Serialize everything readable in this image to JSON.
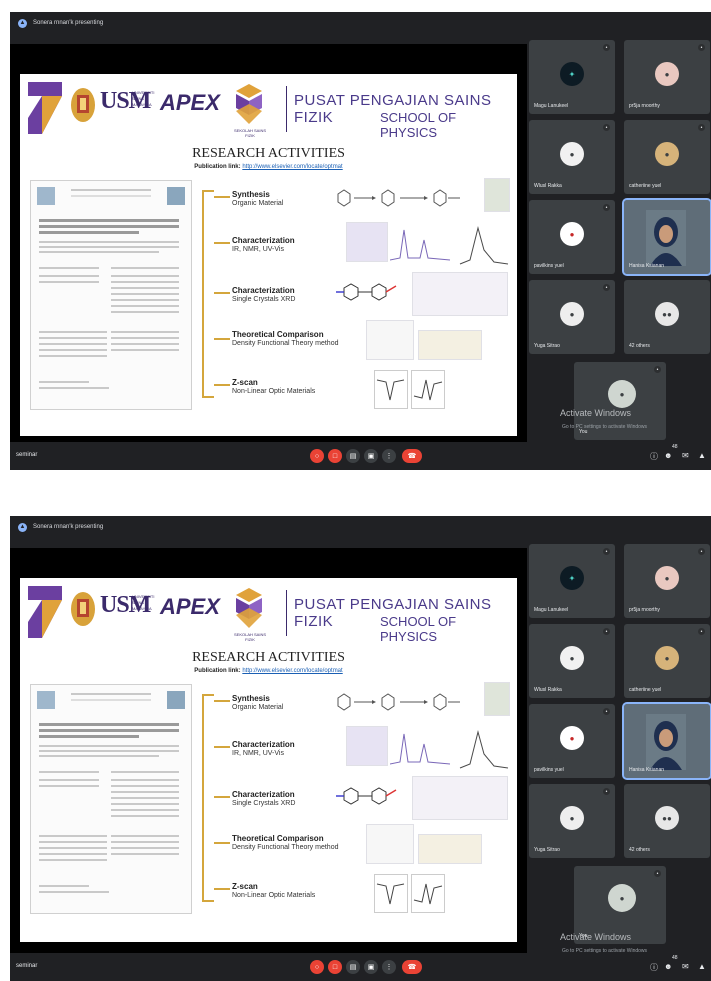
{
  "screens": [
    {
      "topbar": {
        "recording_icon": "present-icon",
        "recording_text": "Sonera rnnan'k presenting"
      },
      "slide": {
        "school_malay": "PUSAT PENGAJIAN SAINS FIZIK",
        "school_english": "SCHOOL OF PHYSICS",
        "usm_text": "USM",
        "usm_subtitle": "UNIVERSITI SAINS MALAYSIA",
        "apex_text": "APEX",
        "cube_label": "SEKOLAH SAINS FIZIK",
        "title": "RESEARCH ACTIVITIES",
        "publication_label": "Publication link:",
        "publication_url": "http://www.elsevier.com/locate/optmat",
        "activities": [
          {
            "heading": "Synthesis",
            "detail": "Organic Material"
          },
          {
            "heading": "Characterization",
            "detail": "IR, NMR, UV-Vis"
          },
          {
            "heading": "Characterization",
            "detail": "Single Crystals XRD"
          },
          {
            "heading": "Theoretical Comparison",
            "detail": "Density Functional Theory method"
          },
          {
            "heading": "Z-scan",
            "detail": "Non-Linear Optic Materials"
          }
        ]
      },
      "participants": [
        {
          "name": "Magu Lanukeel",
          "avatar": "abstract-avatar"
        },
        {
          "name": "pr5ja rnoorthy",
          "avatar": "portrait-avatar"
        },
        {
          "name": "Wlusl Rakka",
          "avatar": "portrait-avatar"
        },
        {
          "name": "catheriine yuel",
          "avatar": "portrait-avatar"
        },
        {
          "name": "pavilkins yuel",
          "avatar": "cartoon-avatar"
        },
        {
          "name": "Hanisa Ksianan",
          "avatar": "presenter-video"
        },
        {
          "name": "Yuga Sitrao",
          "avatar": "portrait-avatar"
        },
        {
          "name": "42 others",
          "avatar": "group-avatar"
        },
        {
          "name": "You",
          "avatar": "self-avatar"
        }
      ],
      "watermark": {
        "title": "Activate Windows",
        "subtitle": "Go to PC settings to activate Windows"
      },
      "bottombar": {
        "meeting_code": "seminar",
        "controls": [
          "mic-off-icon",
          "camera-off-icon",
          "captions-icon",
          "present-icon",
          "more-icon",
          "end-call-icon"
        ],
        "right_icons": [
          "info-icon",
          "people-icon",
          "chat-icon",
          "activities-icon"
        ],
        "people_count": "48"
      }
    },
    {
      "topbar": {
        "recording_icon": "present-icon",
        "recording_text": "Sonera rnnan'k presenting"
      },
      "slide": {
        "school_malay": "PUSAT PENGAJIAN SAINS FIZIK",
        "school_english": "SCHOOL OF PHYSICS",
        "usm_text": "USM",
        "usm_subtitle": "UNIVERSITI SAINS MALAYSIA",
        "apex_text": "APEX",
        "cube_label": "SEKOLAH SAINS FIZIK",
        "title": "RESEARCH ACTIVITIES",
        "publication_label": "Publication link:",
        "publication_url": "http://www.elsevier.com/locate/optmat",
        "activities": [
          {
            "heading": "Synthesis",
            "detail": "Organic Material"
          },
          {
            "heading": "Characterization",
            "detail": "IR, NMR, UV-Vis"
          },
          {
            "heading": "Characterization",
            "detail": "Single Crystals XRD"
          },
          {
            "heading": "Theoretical Comparison",
            "detail": "Density Functional Theory method"
          },
          {
            "heading": "Z-scan",
            "detail": "Non-Linear Optic Materials"
          }
        ]
      },
      "participants": [
        {
          "name": "Magu Lanukeel",
          "avatar": "abstract-avatar"
        },
        {
          "name": "pr5ja rnoorthy",
          "avatar": "portrait-avatar"
        },
        {
          "name": "Wlusl Rakka",
          "avatar": "portrait-avatar"
        },
        {
          "name": "catheriine yuel",
          "avatar": "portrait-avatar"
        },
        {
          "name": "pavilkins yuel",
          "avatar": "cartoon-avatar"
        },
        {
          "name": "Hanisa Ksianan",
          "avatar": "presenter-video"
        },
        {
          "name": "Yuga Sitrao",
          "avatar": "portrait-avatar"
        },
        {
          "name": "42 others",
          "avatar": "group-avatar"
        },
        {
          "name": "You",
          "avatar": "self-avatar"
        }
      ],
      "watermark": {
        "title": "Activate Windows",
        "subtitle": "Go to PC settings to activate Windows"
      },
      "bottombar": {
        "meeting_code": "seminar",
        "controls": [
          "mic-off-icon",
          "camera-off-icon",
          "captions-icon",
          "present-icon",
          "more-icon",
          "end-call-icon"
        ],
        "right_icons": [
          "info-icon",
          "people-icon",
          "chat-icon",
          "activities-icon"
        ],
        "people_count": "48"
      }
    }
  ],
  "colors": {
    "meet_bg": "#202124",
    "tile_bg": "#3c4043",
    "accent_red": "#ea4335",
    "bracket_gold": "#d4a63c",
    "brand_purple": "#4a3a8a"
  }
}
